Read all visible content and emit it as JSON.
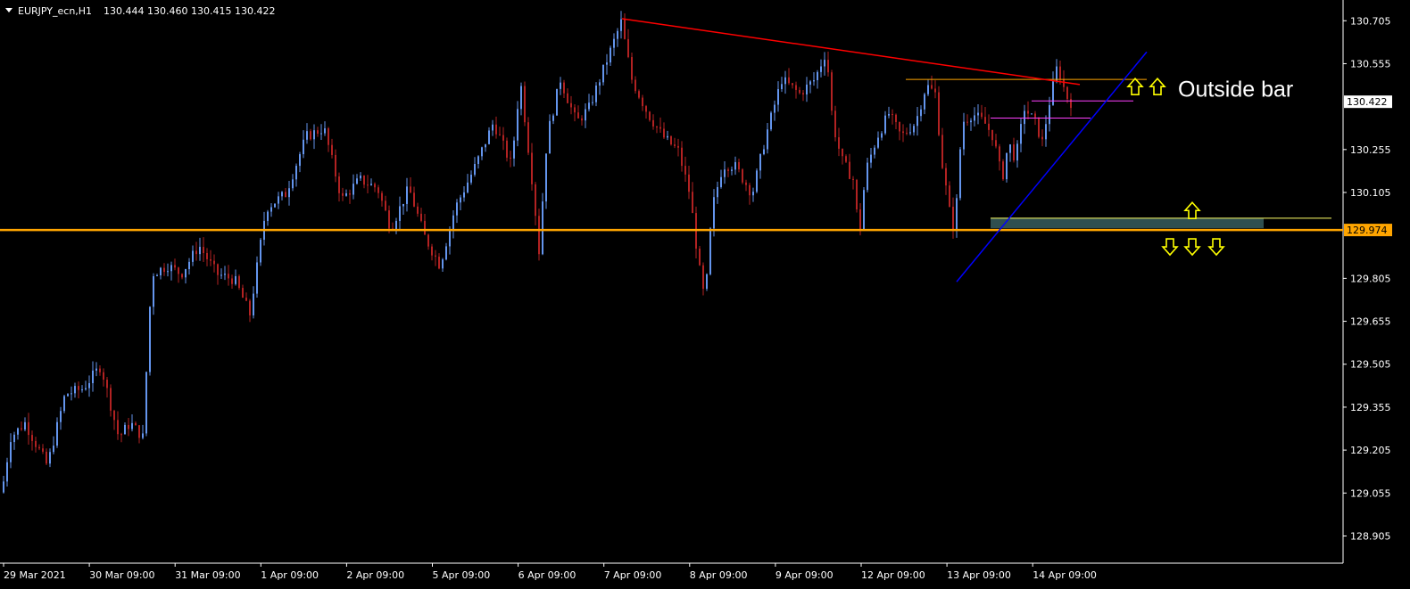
{
  "header": {
    "symbol": "EURJPY_ecn,H1",
    "ohlc": "130.444 130.460 130.415 130.422"
  },
  "chart_data": {
    "type": "candlestick",
    "ylim": [
      128.81,
      130.765
    ],
    "y_ticks": [
      "130.705",
      "130.555",
      "130.255",
      "130.105",
      "129.805",
      "129.655",
      "129.505",
      "129.355",
      "129.205",
      "129.055",
      "128.905"
    ],
    "x_ticks": [
      "29 Mar 2021",
      "30 Mar 09:00",
      "31 Mar 09:00",
      "1 Apr 09:00",
      "2 Apr 09:00",
      "5 Apr 09:00",
      "6 Apr 09:00",
      "7 Apr 09:00",
      "8 Apr 09:00",
      "9 Apr 09:00",
      "12 Apr 09:00",
      "13 Apr 09:00",
      "14 Apr 09:00"
    ],
    "price_labels": [
      {
        "name": "current-price-label",
        "text": "130.422",
        "value": 130.422,
        "bg": "#ffffff",
        "fg": "#000000"
      },
      {
        "name": "support-price-label",
        "text": "129.974",
        "value": 129.974,
        "bg": "#ffa500",
        "fg": "#000000"
      }
    ],
    "keypoints": [
      [
        0,
        128.98
      ],
      [
        14,
        129.25
      ],
      [
        30,
        129.3
      ],
      [
        55,
        129.15
      ],
      [
        75,
        129.4
      ],
      [
        95,
        129.42
      ],
      [
        115,
        129.5
      ],
      [
        135,
        129.25
      ],
      [
        148,
        129.3
      ],
      [
        162,
        129.25
      ],
      [
        172,
        129.82
      ],
      [
        190,
        129.85
      ],
      [
        205,
        129.82
      ],
      [
        225,
        129.92
      ],
      [
        245,
        129.82
      ],
      [
        265,
        129.8
      ],
      [
        282,
        129.68
      ],
      [
        300,
        130.05
      ],
      [
        322,
        130.1
      ],
      [
        345,
        130.3
      ],
      [
        365,
        130.33
      ],
      [
        385,
        130.08
      ],
      [
        405,
        130.15
      ],
      [
        425,
        130.12
      ],
      [
        440,
        129.98
      ],
      [
        460,
        130.12
      ],
      [
        478,
        129.95
      ],
      [
        495,
        129.85
      ],
      [
        512,
        130.05
      ],
      [
        535,
        130.2
      ],
      [
        555,
        130.35
      ],
      [
        575,
        130.2
      ],
      [
        585,
        130.5
      ],
      [
        600,
        130.1
      ],
      [
        606,
        129.9
      ],
      [
        615,
        130.3
      ],
      [
        630,
        130.5
      ],
      [
        648,
        130.35
      ],
      [
        662,
        130.4
      ],
      [
        680,
        130.55
      ],
      [
        698,
        130.7
      ],
      [
        710,
        130.5
      ],
      [
        728,
        130.38
      ],
      [
        745,
        130.3
      ],
      [
        762,
        130.25
      ],
      [
        775,
        130.1
      ],
      [
        785,
        129.85
      ],
      [
        792,
        129.72
      ],
      [
        800,
        130.05
      ],
      [
        812,
        130.2
      ],
      [
        825,
        130.2
      ],
      [
        845,
        130.1
      ],
      [
        860,
        130.3
      ],
      [
        878,
        130.5
      ],
      [
        898,
        130.45
      ],
      [
        915,
        130.5
      ],
      [
        928,
        130.6
      ],
      [
        935,
        130.35
      ],
      [
        945,
        130.22
      ],
      [
        958,
        130.15
      ],
      [
        965,
        129.95
      ],
      [
        972,
        130.18
      ],
      [
        985,
        130.3
      ],
      [
        998,
        130.38
      ],
      [
        1012,
        130.3
      ],
      [
        1028,
        130.35
      ],
      [
        1040,
        130.48
      ],
      [
        1050,
        130.45
      ],
      [
        1058,
        130.2
      ],
      [
        1068,
        130.0
      ],
      [
        1072,
        129.98
      ],
      [
        1080,
        130.35
      ],
      [
        1092,
        130.38
      ],
      [
        1105,
        130.35
      ],
      [
        1115,
        130.3
      ],
      [
        1125,
        130.15
      ],
      [
        1132,
        130.28
      ],
      [
        1140,
        130.22
      ],
      [
        1150,
        130.4
      ],
      [
        1162,
        130.35
      ],
      [
        1170,
        130.28
      ],
      [
        1178,
        130.42
      ],
      [
        1187,
        130.55
      ],
      [
        1193,
        130.48
      ],
      [
        1200,
        130.42
      ]
    ],
    "trendlines": [
      {
        "name": "red-resistance-trendline",
        "color": "#ff0000",
        "p1": [
          697,
          130.712
        ],
        "p2": [
          1210,
          130.482
        ]
      },
      {
        "name": "blue-support-trendline",
        "color": "#0000ff",
        "p1": [
          1072,
          129.793
        ],
        "p2": [
          1285,
          130.596
        ]
      }
    ],
    "hlines": [
      {
        "name": "orange-support-line",
        "color": "#ffa500",
        "y": 129.974,
        "x1": 0,
        "x2": 1505,
        "width": 2.5
      },
      {
        "name": "orange-outside-bar-high-line",
        "color": "#ffa500",
        "y": 130.5,
        "x1": 1015,
        "x2": 1285,
        "width": 1
      },
      {
        "name": "yellow-zone-top-line",
        "color": "#ffff66",
        "y": 130.015,
        "x1": 1110,
        "x2": 1492,
        "width": 1
      },
      {
        "name": "magenta-high-line",
        "color": "#ff40ff",
        "y": 130.425,
        "x1": 1156,
        "x2": 1270,
        "width": 1
      },
      {
        "name": "magenta-low-line",
        "color": "#ff40ff",
        "y": 130.365,
        "x1": 1110,
        "x2": 1222,
        "width": 1
      }
    ],
    "zones": [
      {
        "name": "green-demand-zone",
        "color": "#2f4f4f",
        "y_top": 130.015,
        "y_bottom": 129.98,
        "x1": 1110,
        "x2": 1416
      }
    ],
    "arrows": [
      {
        "name": "yellow-up-arrow",
        "x": 1272,
        "y": 130.475,
        "dir": "up"
      },
      {
        "name": "yellow-up-arrow",
        "x": 1297,
        "y": 130.475,
        "dir": "up"
      },
      {
        "name": "yellow-up-arrow",
        "x": 1336,
        "y": 130.042,
        "dir": "up"
      },
      {
        "name": "yellow-down-arrow",
        "x": 1311,
        "y": 129.915,
        "dir": "down"
      },
      {
        "name": "yellow-down-arrow",
        "x": 1336,
        "y": 129.915,
        "dir": "down"
      },
      {
        "name": "yellow-down-arrow",
        "x": 1363,
        "y": 129.915,
        "dir": "down"
      }
    ],
    "annotations": [
      {
        "name": "outside-bar-annotation",
        "text": "Outside bar",
        "x": 1320,
        "y": 130.44
      }
    ]
  }
}
